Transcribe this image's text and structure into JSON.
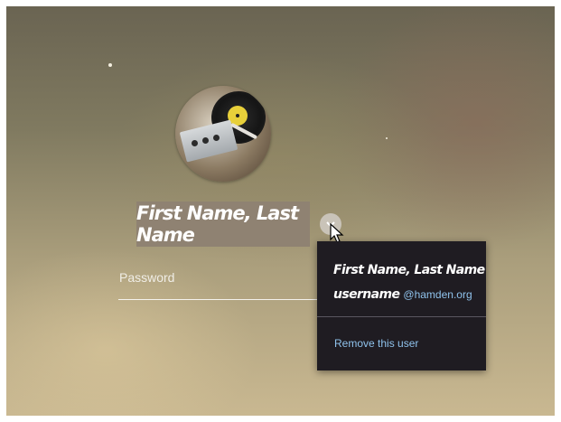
{
  "user": {
    "display_name": "First Name, Last Name",
    "avatar_icon": "record-player-avatar"
  },
  "password": {
    "placeholder": "Password"
  },
  "account_menu": {
    "display_name": "First Name, Last Name",
    "username": "username",
    "domain": "@hamden.org",
    "remove_label": "Remove this user"
  },
  "colors": {
    "menu_background": "#1f1c22",
    "link_blue": "#8fc2ec",
    "name_box": "#8f8272"
  }
}
